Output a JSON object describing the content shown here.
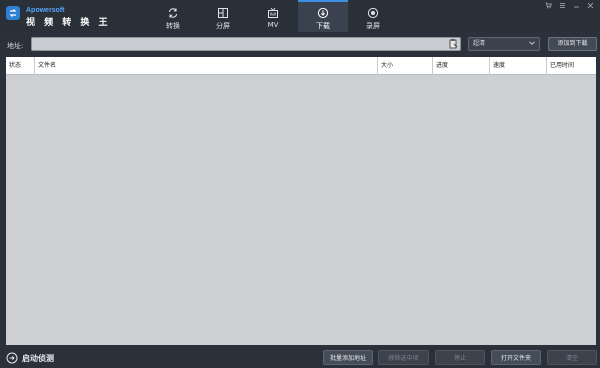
{
  "app": {
    "brand_small": "Apowersoft",
    "brand_title": "视 频 转 换 王",
    "accent_color": "#3d8fe6"
  },
  "nav": {
    "tabs": [
      {
        "label": "转换",
        "icon": "convert-icon"
      },
      {
        "label": "分屏",
        "icon": "split-screen-icon"
      },
      {
        "label": "MV",
        "icon": "mv-icon"
      },
      {
        "label": "下载",
        "icon": "download-icon",
        "active": true
      },
      {
        "label": "录屏",
        "icon": "record-icon"
      }
    ]
  },
  "address": {
    "label": "地址:",
    "value": "",
    "quality": "超清",
    "add_button": "添加到下载"
  },
  "table": {
    "columns": [
      "状态",
      "文件名",
      "大小",
      "进度",
      "速度",
      "已用时间"
    ],
    "rows": []
  },
  "bottom": {
    "status_label": "启动侦测",
    "batch_add": "批量添加地址",
    "remove_selected": "移除选中项",
    "pause": "停止",
    "open_folder": "打开文件夹",
    "clear": "清空"
  }
}
